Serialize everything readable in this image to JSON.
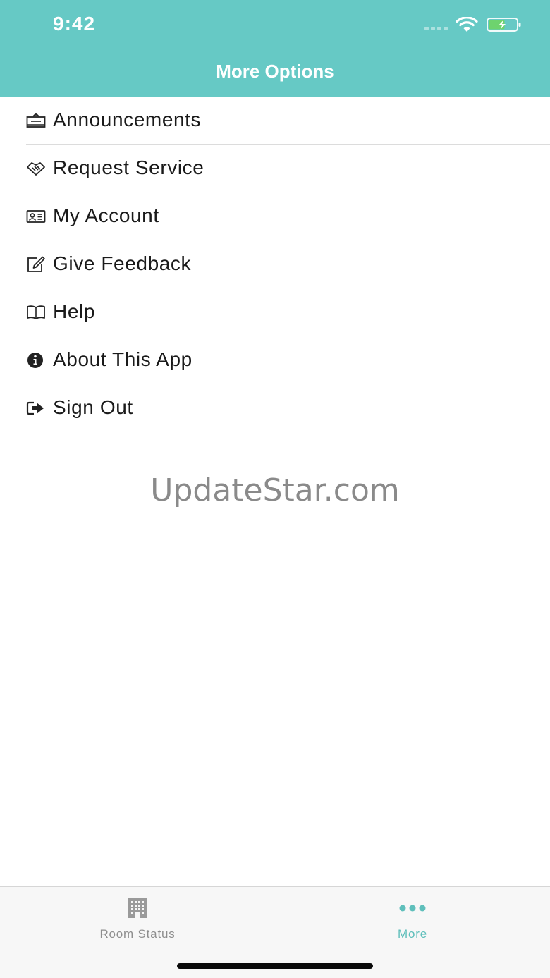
{
  "status_bar": {
    "time": "9:42"
  },
  "header": {
    "title": "More Options",
    "background": "#66c9c5"
  },
  "menu": {
    "items": [
      {
        "label": "Announcements",
        "icon": "announcement-sign-icon"
      },
      {
        "label": "Request Service",
        "icon": "handshake-icon"
      },
      {
        "label": "My Account",
        "icon": "id-card-icon"
      },
      {
        "label": "Give Feedback",
        "icon": "edit-icon"
      },
      {
        "label": "Help",
        "icon": "book-icon"
      },
      {
        "label": "About This App",
        "icon": "info-icon"
      },
      {
        "label": "Sign Out",
        "icon": "sign-out-icon"
      }
    ]
  },
  "watermark": "UpdateStar.com",
  "tabbar": {
    "tabs": [
      {
        "label": "Room Status",
        "icon": "building-icon",
        "active": false
      },
      {
        "label": "More",
        "icon": "ellipsis-icon",
        "active": true
      }
    ],
    "active_color": "#5fbfbb",
    "inactive_color": "#8e8e8e"
  }
}
